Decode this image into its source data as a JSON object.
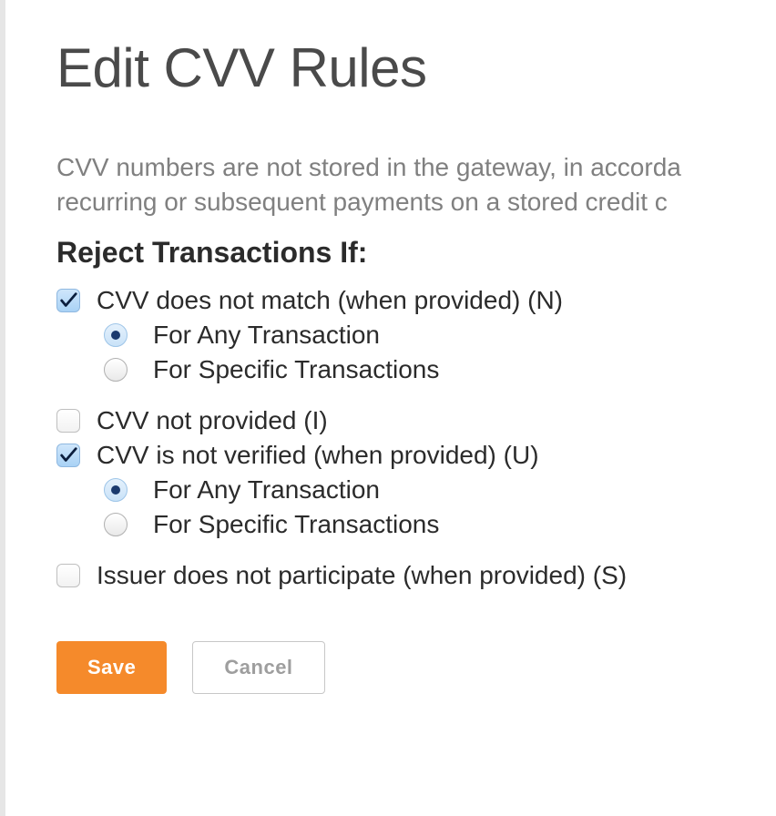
{
  "title": "Edit CVV Rules",
  "intro_line1": "CVV numbers are not stored in the gateway, in accorda",
  "intro_line2": "recurring or subsequent payments on a stored credit c",
  "section_heading": "Reject Transactions If:",
  "rules": {
    "n": {
      "label": "CVV does not match (when provided) (N)",
      "checked": true,
      "options": {
        "any": {
          "label": "For Any Transaction",
          "selected": true
        },
        "specific": {
          "label": "For Specific Transactions",
          "selected": false
        }
      }
    },
    "i": {
      "label": "CVV not provided (I)",
      "checked": false
    },
    "u": {
      "label": "CVV is not verified (when provided) (U)",
      "checked": true,
      "options": {
        "any": {
          "label": "For Any Transaction",
          "selected": true
        },
        "specific": {
          "label": "For Specific Transactions",
          "selected": false
        }
      }
    },
    "s": {
      "label": "Issuer does not participate (when provided) (S)",
      "checked": false
    }
  },
  "buttons": {
    "save": "Save",
    "cancel": "Cancel"
  }
}
